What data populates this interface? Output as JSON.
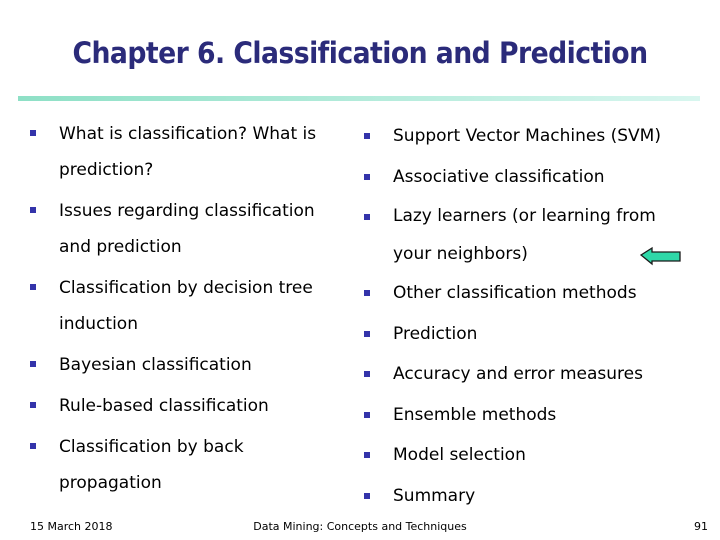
{
  "slide": {
    "title": "Chapter 6. Classification and Prediction",
    "left_items": [
      "What is classification? What is prediction?",
      "Issues regarding classification and prediction",
      "Classification by decision tree induction",
      "Bayesian classification",
      "Rule-based classification",
      "Classification by back propagation"
    ],
    "left_lines": [
      [
        "What is classification? What is",
        "prediction?"
      ],
      [
        "Issues regarding classification",
        "and prediction"
      ],
      [
        "Classification by decision tree",
        "induction"
      ],
      [
        "Bayesian classification"
      ],
      [
        "Rule-based classification"
      ],
      [
        "Classification by back",
        "propagation"
      ]
    ],
    "right_items": [
      "Support Vector Machines (SVM)",
      "Associative classification",
      "Lazy learners (or learning from your neighbors)",
      "Other classification methods",
      "Prediction",
      "Accuracy and error measures",
      "Ensemble methods",
      "Model selection",
      "Summary"
    ],
    "right_lines": [
      [
        "Support Vector Machines (SVM)"
      ],
      [
        "Associative classification"
      ],
      [
        "Lazy learners (or learning from",
        "your neighbors)"
      ],
      [
        "Other classification methods"
      ],
      [
        "Prediction"
      ],
      [
        "Accuracy and error measures"
      ],
      [
        "Ensemble methods"
      ],
      [
        "Model selection"
      ],
      [
        "Summary"
      ]
    ],
    "pointer_icon": "left-arrow-icon",
    "colors": {
      "title": "#2b2b7a",
      "bullet": "#3333aa",
      "arrow": "#2ed8a8",
      "rule": "#8ee0c6"
    }
  },
  "footer": {
    "date": "15 March 2018",
    "center": "Data Mining: Concepts and Techniques",
    "page": "91"
  }
}
